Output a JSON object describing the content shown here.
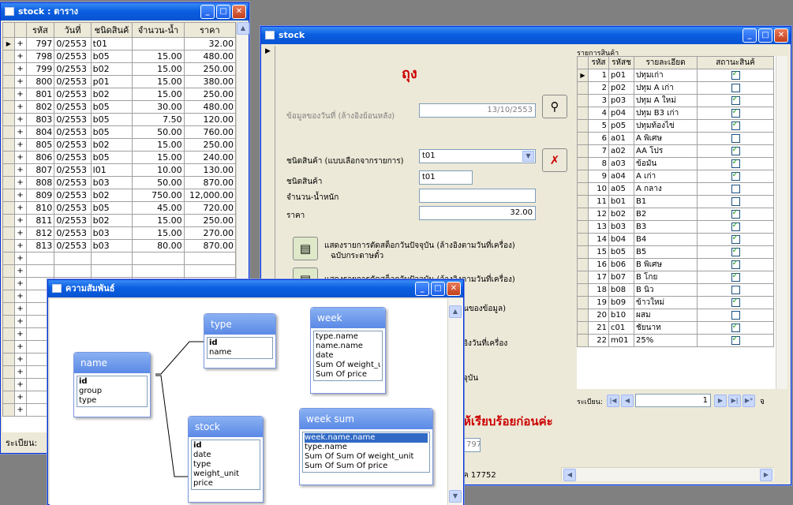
{
  "win1": {
    "title": "stock : ตาราง",
    "headers": [
      "รหัส",
      "วันที่",
      "ชนิดสินค้",
      "จำนวน-น้ำ",
      "ราคา"
    ],
    "rows": [
      [
        "797",
        "0/2553",
        "t01",
        "",
        "32.00"
      ],
      [
        "798",
        "0/2553",
        "b05",
        "15.00",
        "480.00"
      ],
      [
        "799",
        "0/2553",
        "b02",
        "15.00",
        "250.00"
      ],
      [
        "800",
        "0/2553",
        "p01",
        "15.00",
        "380.00"
      ],
      [
        "801",
        "0/2553",
        "b02",
        "15.00",
        "250.00"
      ],
      [
        "802",
        "0/2553",
        "b05",
        "30.00",
        "480.00"
      ],
      [
        "803",
        "0/2553",
        "b05",
        "7.50",
        "120.00"
      ],
      [
        "804",
        "0/2553",
        "b05",
        "50.00",
        "760.00"
      ],
      [
        "805",
        "0/2553",
        "b02",
        "15.00",
        "250.00"
      ],
      [
        "806",
        "0/2553",
        "b05",
        "15.00",
        "240.00"
      ],
      [
        "807",
        "0/2553",
        "l01",
        "10.00",
        "130.00"
      ],
      [
        "808",
        "0/2553",
        "b03",
        "50.00",
        "870.00"
      ],
      [
        "809",
        "0/2553",
        "b02",
        "750.00",
        "12,000.00"
      ],
      [
        "810",
        "0/2553",
        "b05",
        "45.00",
        "720.00"
      ],
      [
        "811",
        "0/2553",
        "b02",
        "15.00",
        "250.00"
      ],
      [
        "812",
        "0/2553",
        "b03",
        "15.00",
        "270.00"
      ],
      [
        "813",
        "0/2553",
        "b03",
        "80.00",
        "870.00"
      ]
    ],
    "nav_label": "ระเบียน:"
  },
  "win2": {
    "title": "stock",
    "heading": "ถุง",
    "date_label": "ข้อมูลของวันที่ (ล้างอิงย้อนหลัง)",
    "date_value": "13/10/2553",
    "type_select_label": "ชนิดสินค้า (แบบเลือกจากรายการ)",
    "type_select_value": "t01",
    "type_label": "ชนิดสินค้า",
    "type_value": "t01",
    "weight_label": "จำนวน-น้ำหนัก",
    "weight_value": "",
    "price_label": "ราคา",
    "price_value": "32.00",
    "action1_line1": "แสดงรายการตัดสต็อกวันปัจจุบัน (ล้างอิงตามวันที่เครื่อง)",
    "action1_line2": "ฉบับกระดาษตั๋ว",
    "action2_partial": "แสดงรายการตัดสต็อกวันปัจจุบัน (ล้างอิงตามวันที่เครื่อง)",
    "frag1": "นของข้อมูล)",
    "frag2": "อิงวันที่เครื่อง",
    "frag3": "จุบัน",
    "notice": "ห้เรียบร้อยก่อนค่ะ",
    "small_value": "797",
    "bottom_frag": "ค 17752",
    "list_title": "รายการสินค้า",
    "list_headers": [
      "รหัส",
      "รหัสช",
      "รายละเอียด",
      "สถานะสินค้"
    ],
    "list_rows": [
      [
        "1",
        "p01",
        "ปทุมเก่า",
        true
      ],
      [
        "2",
        "p02",
        "ปทุม A เก่า",
        false
      ],
      [
        "3",
        "p03",
        "ปทุม A ใหม่",
        true
      ],
      [
        "4",
        "p04",
        "ปทุม B3 เก่า",
        true
      ],
      [
        "5",
        "p05",
        "ปทุมท้องไข่",
        true
      ],
      [
        "6",
        "a01",
        "A พิเศษ",
        false
      ],
      [
        "7",
        "a02",
        "AA โปร",
        true
      ],
      [
        "8",
        "a03",
        "ข้อมัน",
        true
      ],
      [
        "9",
        "a04",
        "A เก่า",
        true
      ],
      [
        "10",
        "a05",
        "A กลาง",
        false
      ],
      [
        "11",
        "b01",
        "B1",
        false
      ],
      [
        "12",
        "b02",
        "B2",
        true
      ],
      [
        "13",
        "b03",
        "B3",
        true
      ],
      [
        "14",
        "b04",
        "B4",
        true
      ],
      [
        "15",
        "b05",
        "B5",
        true
      ],
      [
        "16",
        "b06",
        "B พิเศษ",
        true
      ],
      [
        "17",
        "b07",
        "B โกย",
        true
      ],
      [
        "18",
        "b08",
        "B นิว",
        false
      ],
      [
        "19",
        "b09",
        "ข้าวใหม่",
        true
      ],
      [
        "20",
        "b10",
        "ผสม",
        false
      ],
      [
        "21",
        "c01",
        "ชัยนาท",
        true
      ],
      [
        "22",
        "m01",
        "25%",
        true
      ]
    ],
    "list_nav_label": "ระเบียน:",
    "list_nav_value": "1",
    "list_nav_suffix": "จ"
  },
  "win3": {
    "title": "ความสัมพันธ์",
    "tables": [
      {
        "key": "name",
        "title": "name",
        "fields": [
          "id",
          "group",
          "type"
        ]
      },
      {
        "key": "type",
        "title": "type",
        "fields": [
          "id",
          "name"
        ]
      },
      {
        "key": "week",
        "title": "week",
        "fields": [
          "type.name",
          "name.name",
          "date",
          "Sum Of weight_u",
          "Sum Of price"
        ]
      },
      {
        "key": "stock",
        "title": "stock",
        "fields": [
          "id",
          "date",
          "type",
          "weight_unit",
          "price"
        ]
      },
      {
        "key": "weeksum",
        "title": "week sum",
        "fields": [
          "week.name.name",
          "type.name",
          "Sum Of Sum Of weight_unit",
          "Sum Of Sum Of price"
        ]
      }
    ]
  },
  "bold_fields": [
    "id"
  ],
  "highlight_field": "week.name.name"
}
